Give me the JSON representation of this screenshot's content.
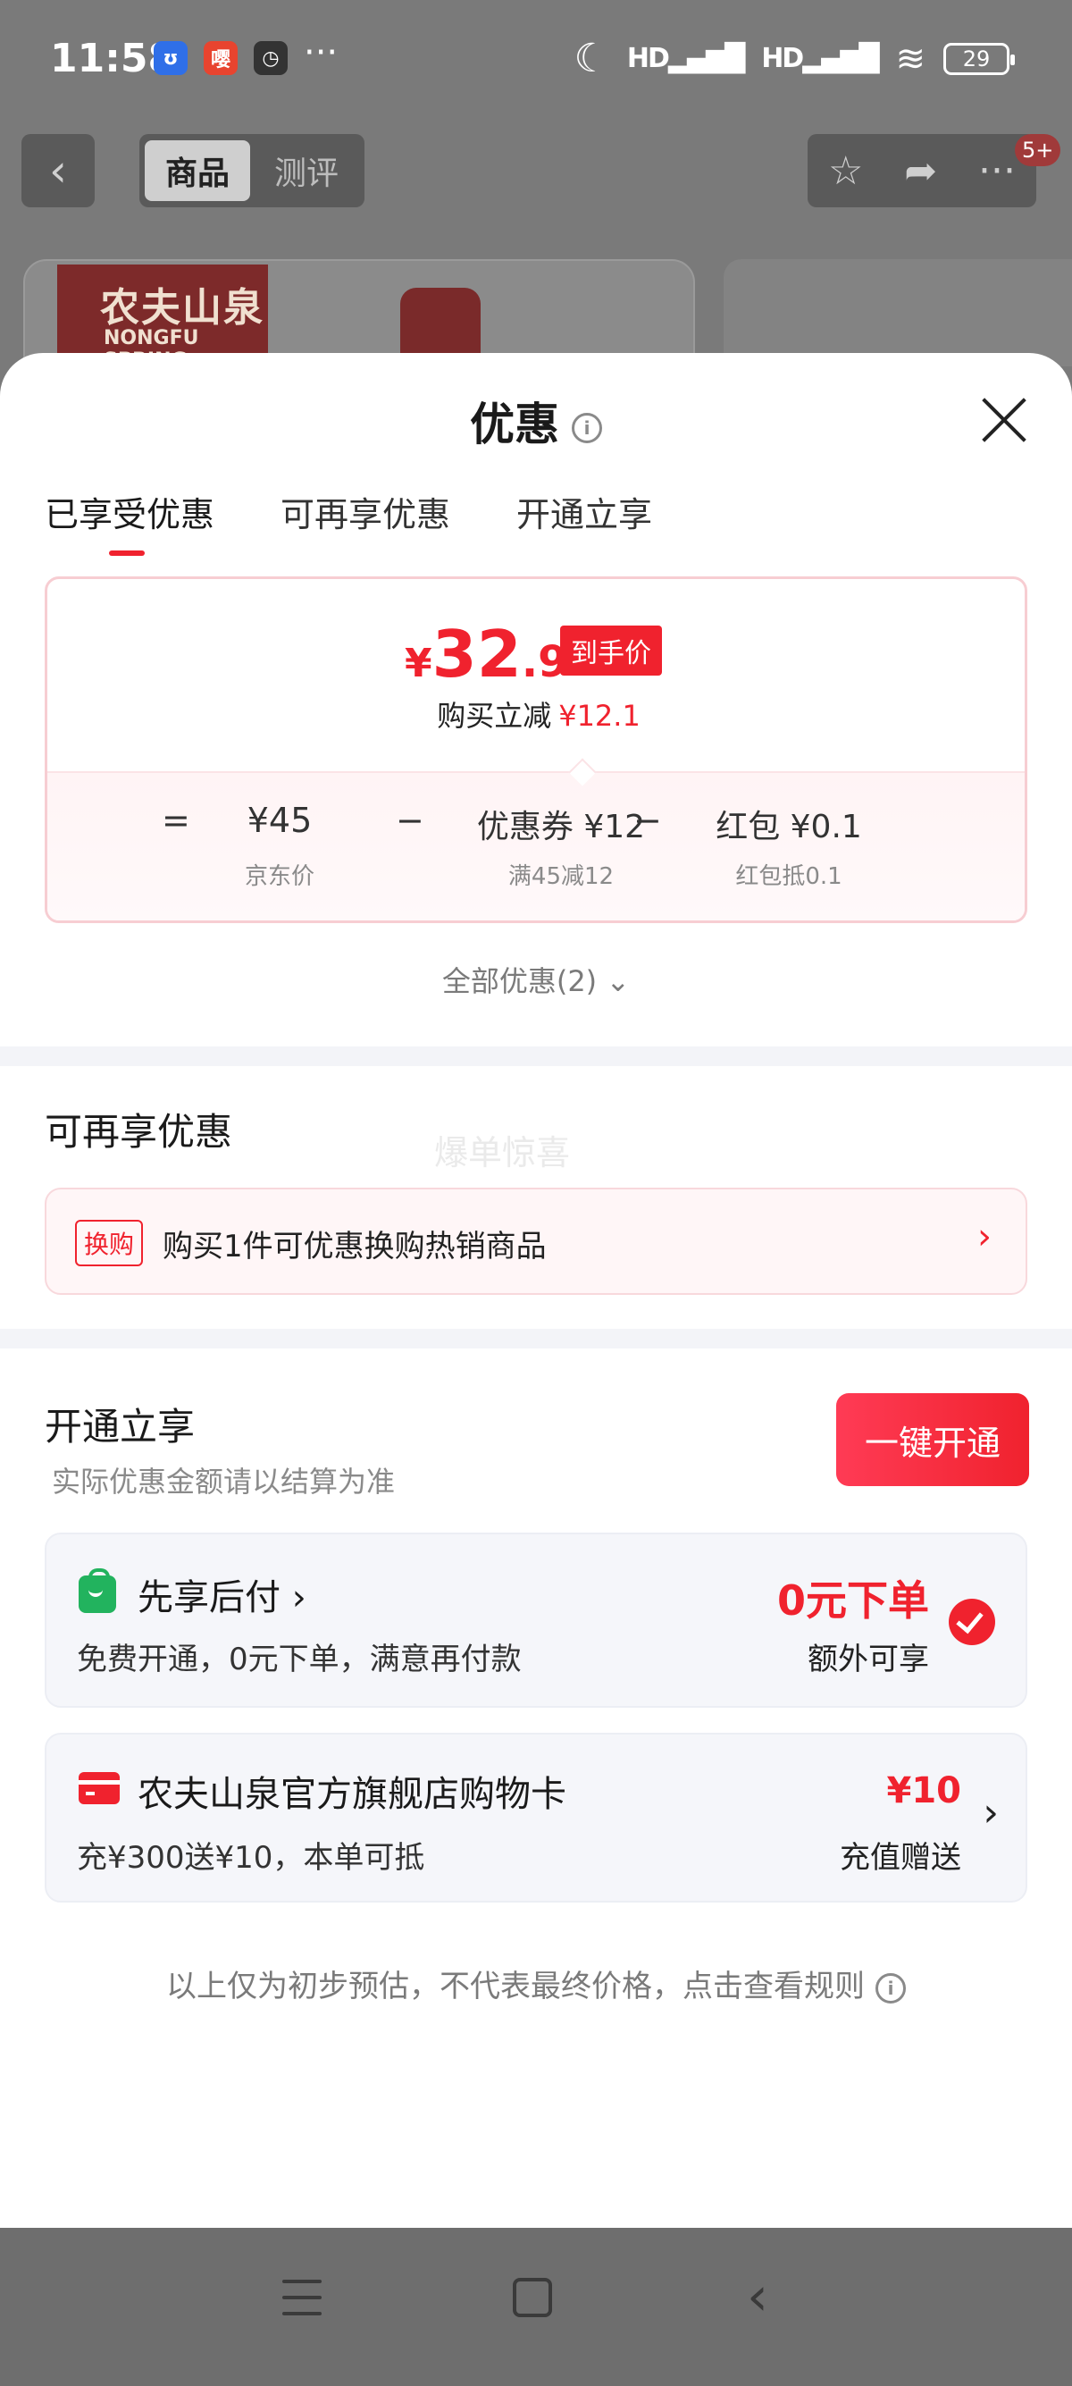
{
  "status_bar": {
    "time": "11:58",
    "app_icons": [
      {
        "name": "shield-app-icon",
        "glyph": "ʊ",
        "color": "#2f6fe8"
      },
      {
        "name": "red-app-icon",
        "glyph": "嘤",
        "color": "#e8442f"
      },
      {
        "name": "clock-app-icon",
        "glyph": "◷",
        "color": "#333333"
      }
    ],
    "more": "···",
    "signal1": "HD▂▄▆█",
    "signal2": "HD▂▄▆█",
    "wifi": "≋",
    "battery": "29"
  },
  "background_page": {
    "tabs": [
      "商品",
      "测评"
    ],
    "active_tab": 0,
    "badge": "5+",
    "brand_cn": "农夫山泉",
    "brand_en": "NONGFU SPRING"
  },
  "sheet": {
    "title": "优惠",
    "tabs": [
      "已享受优惠",
      "可再享优惠",
      "开通立享"
    ],
    "active_tab": 0,
    "price": {
      "currency": "¥",
      "integer": "32",
      "decimal": ".9",
      "tag": "到手价",
      "save_label": "购买立减",
      "save_amount": "¥12.1"
    },
    "calc": {
      "eq": "=",
      "items": [
        {
          "value": "¥45",
          "sub": "京东价"
        },
        {
          "value": "优惠券 ¥12",
          "sub": "满45减12"
        },
        {
          "value": "红包 ¥0.1",
          "sub": "红包抵0.1"
        }
      ],
      "minus": "−"
    },
    "all_discounts": "全部优惠(2) ⌄",
    "more_section": {
      "title": "可再享优惠",
      "watermark": "爆单惊喜",
      "badge": "换购",
      "text": "购买1件可优惠换购热销商品",
      "chevron": "›"
    },
    "open_section": {
      "title": "开通立享",
      "hint": "实际优惠金额请以结算为准",
      "button": "一键开通",
      "cards": [
        {
          "title": "先享后付 ›",
          "desc": "免费开通，0元下单，满意再付款",
          "right_big": "0元下单",
          "right_sub": "额外可享",
          "checked": true
        },
        {
          "title": "农夫山泉官方旗舰店购物卡",
          "desc": "充¥300送¥10，本单可抵",
          "right_big": "¥10",
          "right_sub": "充值赠送",
          "chevron": "›"
        }
      ]
    },
    "footer_note": "以上仅为初步预估，不代表最终价格，点击查看规则"
  },
  "nav_bar": {
    "back": "‹"
  }
}
